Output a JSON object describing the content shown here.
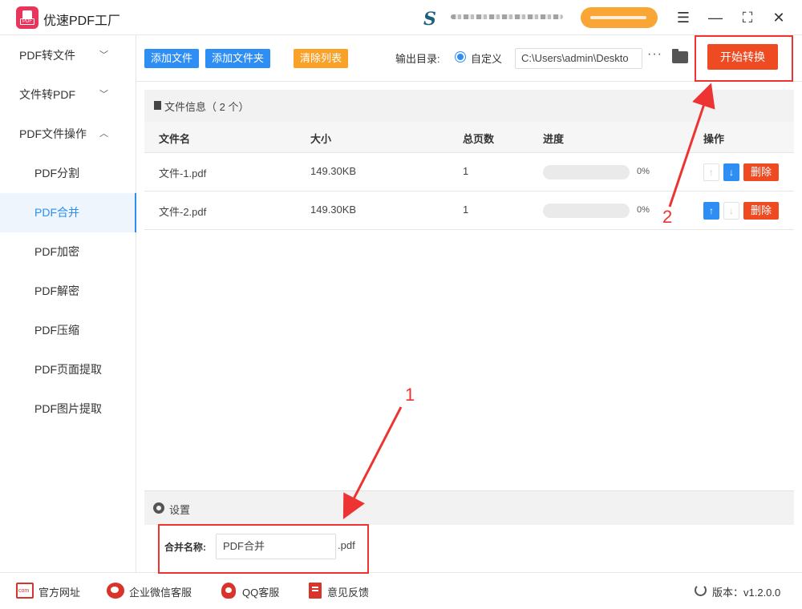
{
  "app": {
    "title": "优速PDF工厂",
    "logo_text": "PDF"
  },
  "titlebar": {
    "sync_logo": "S",
    "icons": [
      "menu-icon",
      "minimize-icon",
      "fullscreen-icon",
      "close-icon"
    ]
  },
  "sidebar": {
    "groups": [
      {
        "label": "PDF转文件",
        "expanded": false
      },
      {
        "label": "文件转PDF",
        "expanded": false
      },
      {
        "label": "PDF文件操作",
        "expanded": true
      }
    ],
    "sub_items": [
      "PDF分割",
      "PDF合并",
      "PDF加密",
      "PDF解密",
      "PDF压缩",
      "PDF页面提取",
      "PDF图片提取"
    ],
    "active": "PDF合并"
  },
  "toolbar": {
    "add_file": "添加文件",
    "add_folder": "添加文件夹",
    "clear_list": "清除列表",
    "output_label": "输出目录:",
    "output_option": "自定义",
    "output_path": "C:\\Users\\admin\\Deskto",
    "more": "···",
    "start": "开始转换"
  },
  "files": {
    "header": "文件信息（ 2 个）",
    "columns": {
      "name": "文件名",
      "size": "大小",
      "pages": "总页数",
      "progress": "进度",
      "actions": "操作"
    },
    "rows": [
      {
        "name": "文件-1.pdf",
        "size": "149.30KB",
        "pages": "1",
        "progress": 0,
        "progress_text": "0%",
        "up_enabled": false,
        "down_enabled": true,
        "delete": "删除"
      },
      {
        "name": "文件-2.pdf",
        "size": "149.30KB",
        "pages": "1",
        "progress": 0,
        "progress_text": "0%",
        "up_enabled": true,
        "down_enabled": false,
        "delete": "删除"
      }
    ]
  },
  "settings": {
    "header": "设置",
    "merge_label": "合并名称:",
    "merge_value": "PDF合并",
    "merge_ext": ".pdf"
  },
  "footer": {
    "links": [
      "官方网址",
      "企业微信客服",
      "QQ客服",
      "意见反馈"
    ],
    "version": "版本：v1.2.0.0"
  },
  "annotations": {
    "step1": "1",
    "step2": "2",
    "color": "#e33333"
  },
  "colors": {
    "primary": "#2f8ef3",
    "danger": "#ef4b23",
    "warning": "#f9a22a",
    "brand": "#e8355b"
  }
}
